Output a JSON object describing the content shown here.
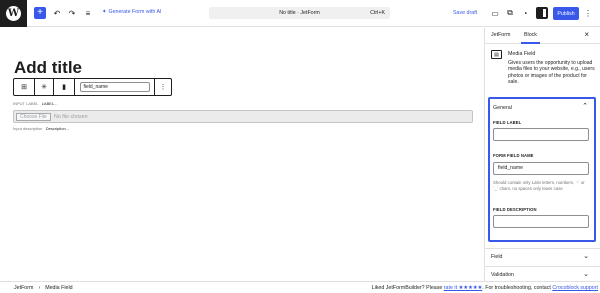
{
  "topbar": {
    "logo_glyph": "W",
    "add_glyph": "+",
    "undo_glyph": "↶",
    "redo_glyph": "↷",
    "list_view_glyph": "≡",
    "generate_ai_label": "Generate Form with AI",
    "document_title": "No title · JetForm",
    "shortcut": "Ctrl+K",
    "save_draft_label": "Save draft",
    "publish_label": "Publish",
    "view_glyph": "▭",
    "external_glyph": "⧉",
    "plugin_glyph": "◔",
    "options_glyph": "⋮"
  },
  "editor": {
    "title_placeholder": "Add title",
    "block_toolbar": {
      "parent_glyph": "⊞",
      "required_glyph": "✳",
      "block_glyph": "▮",
      "field_name_value": "field_name",
      "more_glyph": "⋮"
    },
    "input_label_key": "INPUT LABEL",
    "input_label_value": "LABEL...",
    "file_button_label": "Choose File",
    "file_status": "No file chosen",
    "input_description_key": "Input description",
    "input_description_value": "Description..."
  },
  "sidebar": {
    "tabs": [
      {
        "label": "JetForm"
      },
      {
        "label": "Block"
      }
    ],
    "active_tab": "Block",
    "close_glyph": "×",
    "block": {
      "name": "Media Field",
      "description": "Gives users the opportunity to upload media files to your website, e.g., users photos or images of the product for sale."
    },
    "general": {
      "title": "General",
      "chevron_glyph": "⌃",
      "field_label_title": "FIELD LABEL",
      "field_label_value": "",
      "form_field_name_title": "FORM FIELD NAME",
      "form_field_name_value": "field_name",
      "form_field_name_help": "Should contain only Latin letters, numbers, `-` or `_` chars, no spaces only lower case",
      "field_description_title": "FIELD DESCRIPTION",
      "field_description_value": ""
    },
    "panels": [
      {
        "title": "Field",
        "chevron": "⌄"
      },
      {
        "title": "Validation",
        "chevron": "⌄"
      }
    ]
  },
  "footer": {
    "breadcrumb": [
      "JetForm",
      "Media Field"
    ],
    "breadcrumb_sep": "›",
    "liked_prefix": "Liked JetFormBuilder? Please",
    "rate_link": "rate it ★★★★★",
    "liked_middle": ". For troubleshooting, contact",
    "support_link": "Crocoblock support"
  },
  "colors": {
    "accent": "#3858e9",
    "dark": "#1e1e1e",
    "border": "#e0e0e0"
  }
}
